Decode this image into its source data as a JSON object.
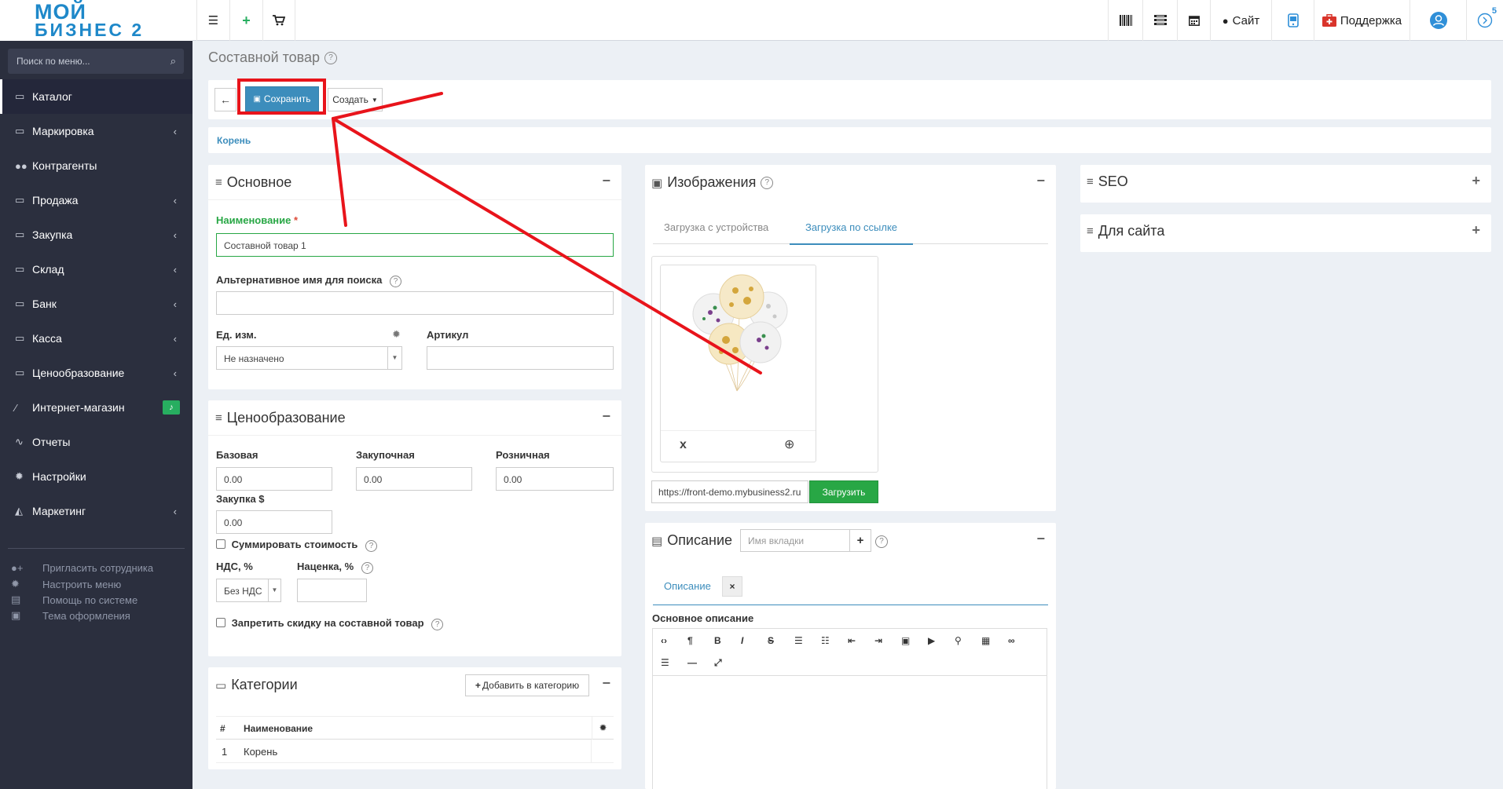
{
  "brand": {
    "line1": "МОЙ",
    "line2": "БИЗНЕС 2"
  },
  "topbar": {
    "site_label": "Сайт",
    "support_label": "Поддержка",
    "notif_count": "5"
  },
  "sidebar": {
    "search_placeholder": "Поиск по меню...",
    "items": [
      {
        "label": "Каталог"
      },
      {
        "label": "Маркировка"
      },
      {
        "label": "Контрагенты"
      },
      {
        "label": "Продажа"
      },
      {
        "label": "Закупка"
      },
      {
        "label": "Склад"
      },
      {
        "label": "Банк"
      },
      {
        "label": "Касса"
      },
      {
        "label": "Ценообразование"
      },
      {
        "label": "Интернет-магазин"
      },
      {
        "label": "Отчеты"
      },
      {
        "label": "Настройки"
      },
      {
        "label": "Маркетинг"
      }
    ],
    "links": [
      {
        "label": "Пригласить сотрудника"
      },
      {
        "label": "Настроить меню"
      },
      {
        "label": "Помощь по системе"
      },
      {
        "label": "Тема оформления"
      }
    ]
  },
  "page": {
    "title": "Составной товар",
    "save_label": "Сохранить",
    "create_label": "Создать",
    "breadcrumb": "Корень"
  },
  "basic": {
    "title": "Основное",
    "name_label": "Наименование",
    "required_mark": "*",
    "name_value": "Составной товар 1",
    "alt_label": "Альтернативное имя для поиска",
    "alt_value": "",
    "unit_label": "Ед. изм.",
    "unit_value": "Не назначено",
    "article_label": "Артикул",
    "article_value": ""
  },
  "pricing": {
    "title": "Ценообразование",
    "base_label": "Базовая",
    "base_value": "0.00",
    "purchase_label": "Закупочная",
    "purchase_value": "0.00",
    "retail_label": "Розничная",
    "retail_value": "0.00",
    "purchase_usd_label": "Закупка $",
    "purchase_usd_value": "0.00",
    "sum_label": "Суммировать стоимость",
    "vat_label": "НДС, %",
    "vat_value": "Без НДС",
    "markup_label": "Наценка, %",
    "markup_value": "",
    "no_discount_label": "Запретить скидку на составной товар"
  },
  "categories": {
    "title": "Категории",
    "add_label": "Добавить в категорию",
    "headers": [
      "#",
      "Наименование"
    ],
    "rows": [
      {
        "num": "1",
        "name": "Корень"
      }
    ]
  },
  "images": {
    "title": "Изображения",
    "tab_device": "Загрузка с устройства",
    "tab_link": "Загрузка по ссылке",
    "delete_glyph": "x",
    "url_value": "https://front-demo.mybusiness2.ru",
    "upload_label": "Загрузить"
  },
  "description": {
    "title": "Описание",
    "tab_name_placeholder": "Имя вкладки",
    "tab_label": "Описание",
    "tab_close": "×",
    "main_label": "Основное описание"
  },
  "right": {
    "seo_title": "SEO",
    "site_title": "Для сайта"
  },
  "colors": {
    "accent": "#3c8dbc",
    "sidebar": "#2b2f3e",
    "success": "#28a745",
    "annotation": "#e8141b"
  }
}
